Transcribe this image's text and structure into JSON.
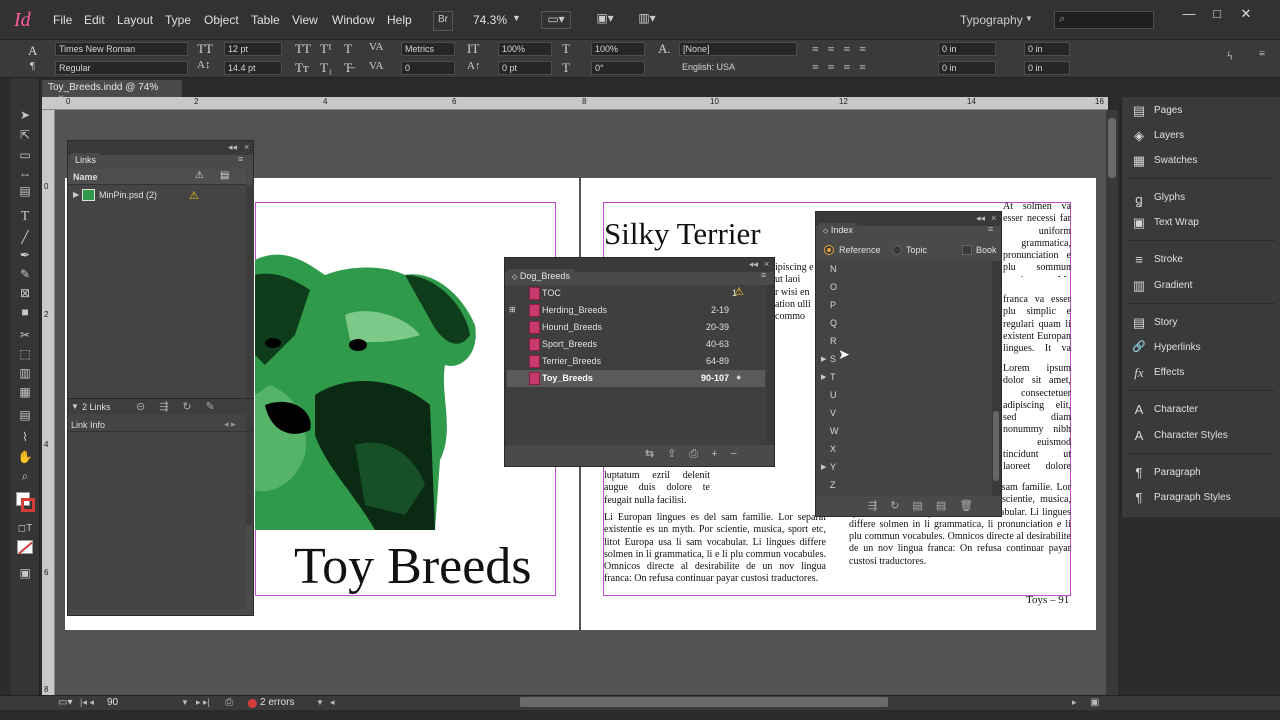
{
  "app": {
    "logo": "Id",
    "menu": [
      "File",
      "Edit",
      "Layout",
      "Type",
      "Object",
      "Table",
      "View",
      "Window",
      "Help"
    ],
    "bridge_label": "Br",
    "zoom": "74.3%",
    "workspace": "Typography"
  },
  "control": {
    "font_family": "Times New Roman",
    "font_style": "Regular",
    "font_size": "12 pt",
    "leading": "14.4 pt",
    "kerning": "Metrics",
    "tracking": "0",
    "vscale": "100%",
    "hscale": "100%",
    "baseline": "0 pt",
    "skew": "0°",
    "char_style": "[None]",
    "language": "English: USA",
    "indent_left": "0 in",
    "indent_right": "0 in",
    "first_indent": "0 in",
    "last_indent": "0 in",
    "space_before": "0 in",
    "space_after": "0 in"
  },
  "document": {
    "tab_title": "Toy_Breeds.indd @ 74%",
    "ruler_h": [
      "0",
      "2",
      "4",
      "6",
      "8",
      "10",
      "12",
      "14",
      "16"
    ],
    "ruler_v": [
      "0",
      "2",
      "4",
      "6",
      "8"
    ],
    "left_page_title": "Toy Breeds",
    "right_page_title": "Silky Terrier",
    "folio": "Toys – 91",
    "col1_top": "ipiscing e\nut laoi\nr wisi en\nation ulli\ncommo",
    "col1_bottom_a": "luptatum ezril delenit augue duis dolore te feugait nulla facilisi.",
    "col1_bottom_b": "Li Europan lingues es del sam familie. Lor separat existentie es un myth. Por scientie, musica, sport etc, litot Europa usa li sam vocabular. Li lingues differe solmen in li grammatica, li e li plu commun vocabules. Omnicos directe al desirabilite de un nov lingua franca: On refusa continuar payar custosi traductores.",
    "col2_top_a": "At solmen va esser necessi far uniform grammatica, pronunciation e plu sommun paroles. Ma quande lingues coalesce, li grammatica del resultant lingue es plu simplic e regulari quam ti del coalescent lingues. Li nov lingua",
    "col2_top_b": "franca va esser plu simplic e regulari quam li existent Europan lingues. It va esser tam simplic quam Occidental in fact, it va esser Occidental. A un Angleso it va semblar un simplificat Angles, quam un skeptic Cambridge amico dit me que Occidental.",
    "col2_mid": "Lorem ipsum dolor sit amet, consectetuer adipiscing elit, sed diam nonummy nibh euismod tincidunt ut laoreet dolore magna aliquam erat volutpat. Ut wisi enim ad minim veniam, quis nostrud exerci tation ullamcorper suscipit lobortis nisl ut aliquip ex ea commodo consequat. Duis autem vel eum iriure dolor in hendrerit in vulputate velit esse molestie consequat. Vel illum dolore eu feugiat nulla facilisis at vero eros et accumsan et iusto odio dignissim qui blandit praesent luptatum zzril delenit augue duis dolore te feugait nulla facilisi.",
    "col2_bottom": "Li Europan lingues es membres del sam familie. Lor separat existentie es un myth. Por scientie, musica, sport etc, litot Europa usa li sam vocabular. Li lingues differe solmen in li grammatica, li pronunciation e li plu commun vocabules. Omnicos directe al desirabilite de un nov lingua franca: On refusa continuar payar custosi traductores."
  },
  "links_panel": {
    "tab": "Links",
    "col_name": "Name",
    "items": [
      {
        "name": "MinPin.psd (2)"
      }
    ],
    "count": "2 Links",
    "info_label": "Link Info"
  },
  "book_panel": {
    "tab": "Dog_Breeds",
    "docs": [
      {
        "name": "TOC",
        "pages": "1"
      },
      {
        "name": "Herding_Breeds",
        "pages": "2-19"
      },
      {
        "name": "Hound_Breeds",
        "pages": "20-39"
      },
      {
        "name": "Sport_Breeds",
        "pages": "40-63"
      },
      {
        "name": "Terrier_Breeds",
        "pages": "64-89"
      },
      {
        "name": "Toy_Breeds",
        "pages": "90-107"
      }
    ]
  },
  "index_panel": {
    "tab": "Index",
    "mode_reference": "Reference",
    "mode_topic": "Topic",
    "book_label": "Book",
    "letters": [
      "N",
      "O",
      "P",
      "Q",
      "R",
      "S",
      "T",
      "U",
      "V",
      "W",
      "X",
      "Y",
      "Z"
    ]
  },
  "dock": {
    "items": [
      {
        "label": "Pages",
        "icon": "pages-icon",
        "glyph": "▤"
      },
      {
        "label": "Layers",
        "icon": "layers-icon",
        "glyph": "◈"
      },
      {
        "label": "Swatches",
        "icon": "swatches-icon",
        "glyph": "▦"
      },
      {
        "label": "Glyphs",
        "icon": "glyphs-icon",
        "glyph": "ꬶ"
      },
      {
        "label": "Text Wrap",
        "icon": "text-wrap-icon",
        "glyph": "▣"
      },
      {
        "label": "Stroke",
        "icon": "stroke-icon",
        "glyph": "≡"
      },
      {
        "label": "Gradient",
        "icon": "gradient-icon",
        "glyph": "▥"
      },
      {
        "label": "Story",
        "icon": "story-icon",
        "glyph": "▤"
      },
      {
        "label": "Hyperlinks",
        "icon": "hyperlinks-icon",
        "glyph": "🔗"
      },
      {
        "label": "Effects",
        "icon": "effects-icon",
        "glyph": "fx"
      },
      {
        "label": "Character",
        "icon": "character-icon",
        "glyph": "A"
      },
      {
        "label": "Character Styles",
        "icon": "character-styles-icon",
        "glyph": "A"
      },
      {
        "label": "Paragraph",
        "icon": "paragraph-icon",
        "glyph": "¶"
      },
      {
        "label": "Paragraph Styles",
        "icon": "paragraph-styles-icon",
        "glyph": "¶"
      }
    ]
  },
  "status": {
    "page": "90",
    "errors": "2 errors"
  },
  "colors": {
    "accent_magenta": "#c24bd1",
    "dog_green": "#2f9a4a",
    "warning_yellow": "#f2c518",
    "error_red": "#d43c3c"
  }
}
